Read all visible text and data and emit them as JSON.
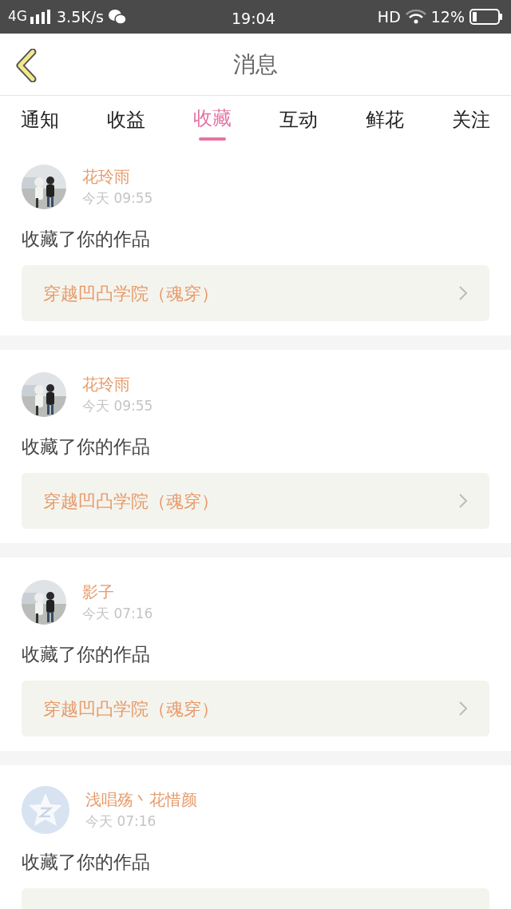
{
  "status_bar": {
    "network": "4G",
    "speed": "3.5K/s",
    "time": "19:04",
    "hd": "HD",
    "battery": "12%"
  },
  "header": {
    "title": "消息"
  },
  "tabs": [
    {
      "label": "通知",
      "selected": false
    },
    {
      "label": "收益",
      "selected": false
    },
    {
      "label": "收藏",
      "selected": true
    },
    {
      "label": "互动",
      "selected": false
    },
    {
      "label": "鲜花",
      "selected": false
    },
    {
      "label": "关注",
      "selected": false
    }
  ],
  "messages": [
    {
      "name": "花玲雨",
      "time": "今天 09:55",
      "text": "收藏了你的作品",
      "work": "穿越凹凸学院（魂穿）"
    },
    {
      "name": "花玲雨",
      "time": "今天 09:55",
      "text": "收藏了你的作品",
      "work": "穿越凹凸学院（魂穿）"
    },
    {
      "name": "影子",
      "time": "今天 07:16",
      "text": "收藏了你的作品",
      "work": "穿越凹凸学院（魂穿）"
    },
    {
      "avatar": {
        "kind": "default"
      },
      "name": "浅唱殇丶花惜颜",
      "time": "今天 07:16",
      "text": "收藏了你的作品"
    }
  ]
}
